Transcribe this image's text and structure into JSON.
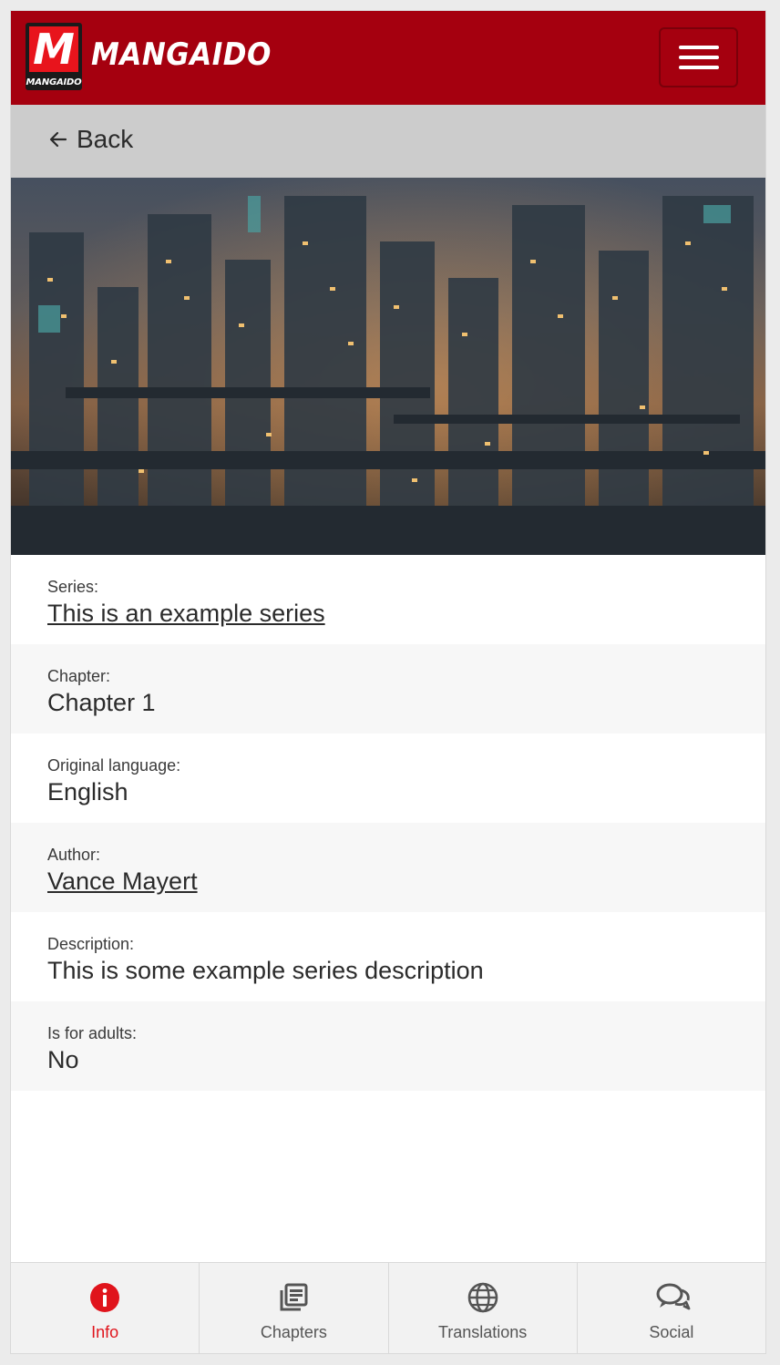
{
  "header": {
    "logo_letter": "M",
    "logo_caption": "MANGAIDO",
    "brand": "MANGAIDO",
    "menu_icon": "hamburger-menu-icon",
    "brand_color": "#a5000f"
  },
  "back": {
    "label": "Back",
    "icon": "arrow-left-icon"
  },
  "cover": {
    "icon": "cover-image"
  },
  "details": [
    {
      "label": "Series:",
      "value": "This is an example series",
      "link": true
    },
    {
      "label": "Chapter:",
      "value": "Chapter 1",
      "link": false
    },
    {
      "label": "Original language:",
      "value": "English",
      "link": false
    },
    {
      "label": "Author:",
      "value": "Vance Mayert",
      "link": true
    },
    {
      "label": "Description:",
      "value": "This is some example series description",
      "link": false
    },
    {
      "label": "Is for adults:",
      "value": "No",
      "link": false
    }
  ],
  "nav": {
    "active_color": "#e0141c",
    "items": [
      {
        "label": "Info",
        "icon": "info-icon",
        "active": true
      },
      {
        "label": "Chapters",
        "icon": "chapters-icon",
        "active": false
      },
      {
        "label": "Translations",
        "icon": "globe-icon",
        "active": false
      },
      {
        "label": "Social",
        "icon": "chat-bubbles-icon",
        "active": false
      }
    ]
  }
}
